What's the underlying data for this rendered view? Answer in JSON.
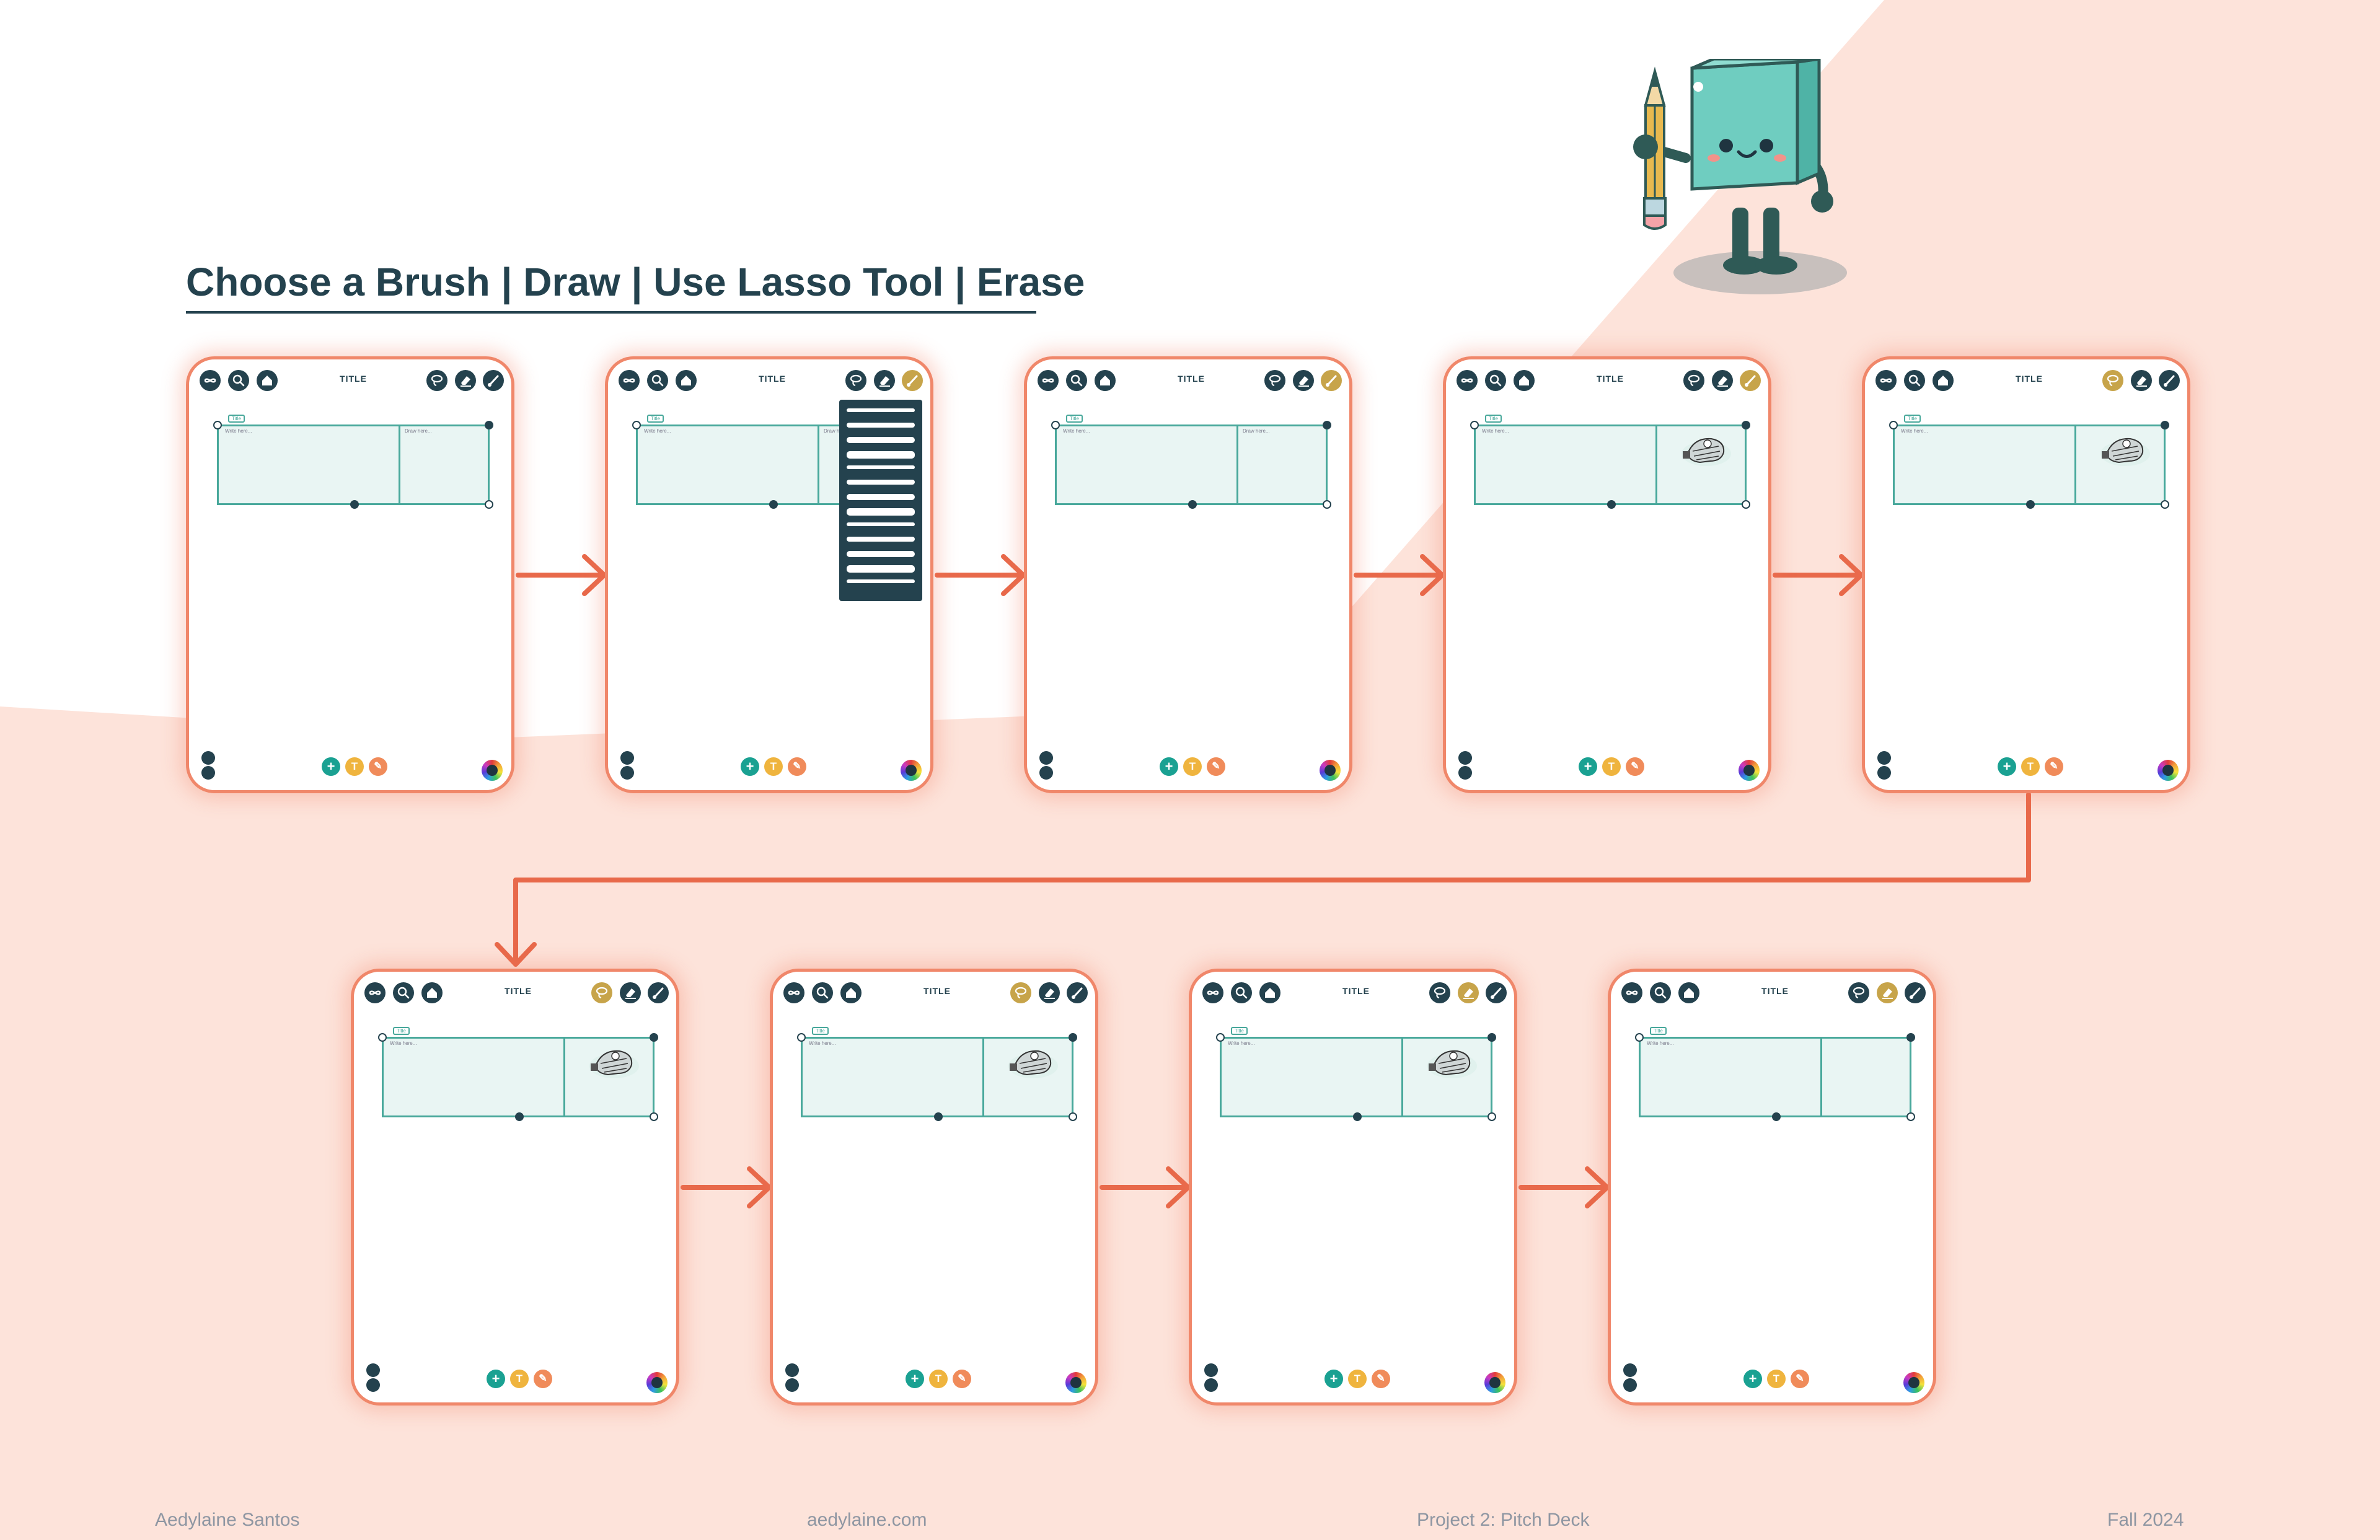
{
  "heading": "Choose a Brush | Draw | Use Lasso Tool | Erase",
  "screens": [
    {
      "title": "TITLE",
      "tag": "Title",
      "write_placeholder": "Write here...",
      "draw_placeholder": "Draw here...",
      "sketch": false,
      "active_tool": "none",
      "brush_menu_open": false
    },
    {
      "title": "TITLE",
      "tag": "Title",
      "write_placeholder": "Write here...",
      "draw_placeholder": "Draw here...",
      "sketch": false,
      "active_tool": "brush",
      "brush_menu_open": true
    },
    {
      "title": "TITLE",
      "tag": "Title",
      "write_placeholder": "Write here...",
      "draw_placeholder": "Draw here...",
      "sketch": false,
      "active_tool": "brush",
      "brush_menu_open": false
    },
    {
      "title": "TITLE",
      "tag": "Title",
      "write_placeholder": "Write here...",
      "draw_placeholder": "",
      "sketch": true,
      "active_tool": "brush",
      "brush_menu_open": false
    },
    {
      "title": "TITLE",
      "tag": "Title",
      "write_placeholder": "Write here...",
      "draw_placeholder": "",
      "sketch": true,
      "active_tool": "lasso",
      "brush_menu_open": false
    },
    {
      "title": "TITLE",
      "tag": "Title",
      "write_placeholder": "Write here...",
      "draw_placeholder": "",
      "sketch": true,
      "active_tool": "lasso",
      "brush_menu_open": false
    },
    {
      "title": "TITLE",
      "tag": "Title",
      "write_placeholder": "Write here...",
      "draw_placeholder": "",
      "sketch": true,
      "active_tool": "lasso",
      "brush_menu_open": false
    },
    {
      "title": "TITLE",
      "tag": "Title",
      "write_placeholder": "Write here...",
      "draw_placeholder": "",
      "sketch": true,
      "active_tool": "eraser",
      "brush_menu_open": false
    },
    {
      "title": "TITLE",
      "tag": "Title",
      "write_placeholder": "Write here...",
      "draw_placeholder": "",
      "sketch": false,
      "active_tool": "eraser",
      "brush_menu_open": false
    }
  ],
  "icons": {
    "top_left": [
      "infinity-icon",
      "search-icon",
      "home-icon"
    ],
    "top_right": [
      "lasso-icon",
      "eraser-icon",
      "brush-icon"
    ],
    "bottom": [
      "plus-icon",
      "text-icon",
      "pen-icon",
      "color-wheel-icon"
    ],
    "side": [
      "undo-icon",
      "redo-icon"
    ]
  },
  "footer": {
    "author": "Aedylaine Santos",
    "site": "aedylaine.com",
    "project": "Project 2: Pitch Deck",
    "term": "Fall 2024"
  },
  "colors": {
    "background_white": "#ffffff",
    "background_peach": "#fde3da",
    "heading": "#24424e",
    "arrow": "#e8694a",
    "board_fill": "#e9f5f3",
    "board_border": "#48a89b",
    "icon_dark": "#24424e",
    "active_tool": "#c7a44a",
    "mascot": "#6fcdc0"
  }
}
